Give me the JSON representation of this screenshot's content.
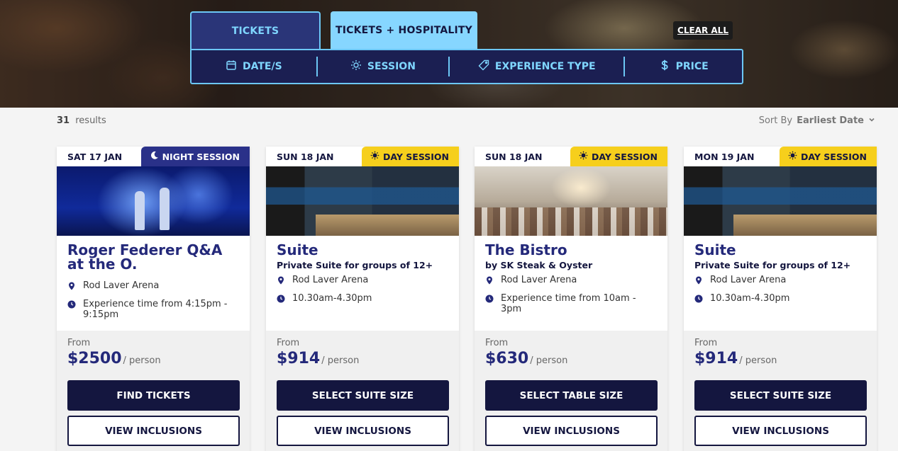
{
  "tabs": [
    {
      "label": "TICKETS",
      "active": false
    },
    {
      "label": "TICKETS + HOSPITALITY",
      "active": true
    }
  ],
  "clear_all_label": "CLEAR ALL",
  "filters": [
    {
      "label": "DATE/S",
      "icon": "calendar-icon"
    },
    {
      "label": "SESSION",
      "icon": "sun-icon"
    },
    {
      "label": "EXPERIENCE TYPE",
      "icon": "tag-icon"
    },
    {
      "label": "PRICE",
      "icon": "dollar-icon"
    }
  ],
  "results": {
    "count": "31",
    "label": "results"
  },
  "sort": {
    "label": "Sort By",
    "value": "Earliest Date",
    "icon": "chevron-down-icon"
  },
  "colors": {
    "navy": "#14163f",
    "accent_blue": "#6cc7f5",
    "night_badge": "#2a3189",
    "day_badge": "#f6cf1c",
    "title_blue": "#24297a"
  },
  "cards": [
    {
      "date": "SAT 17 JAN",
      "session": "NIGHT SESSION",
      "session_icon": "moon-icon",
      "title": "Roger Federer Q&A at the O.",
      "subtitle": "",
      "venue": "Rod Laver Arena",
      "time": "Experience time from 4:15pm - 9:15pm",
      "from_label": "From",
      "price": "$2500",
      "per": "/ person",
      "primary_button": "FIND TICKETS",
      "secondary_button": "VIEW INCLUSIONS"
    },
    {
      "date": "SUN 18 JAN",
      "session": "DAY SESSION",
      "session_icon": "sun-icon",
      "title": "Suite",
      "subtitle": "Private Suite for groups of 12+",
      "venue": "Rod Laver Arena",
      "time": "10.30am-4.30pm",
      "from_label": "From",
      "price": "$914",
      "per": "/ person",
      "primary_button": "SELECT SUITE SIZE",
      "secondary_button": "VIEW INCLUSIONS"
    },
    {
      "date": "SUN 18 JAN",
      "session": "DAY SESSION",
      "session_icon": "sun-icon",
      "title": "The Bistro",
      "subtitle": "by SK Steak & Oyster",
      "venue": "Rod Laver Arena",
      "time": "Experience time from 10am - 3pm",
      "from_label": "From",
      "price": "$630",
      "per": "/ person",
      "primary_button": "SELECT TABLE SIZE",
      "secondary_button": "VIEW INCLUSIONS"
    },
    {
      "date": "MON 19 JAN",
      "session": "DAY SESSION",
      "session_icon": "sun-icon",
      "title": "Suite",
      "subtitle": "Private Suite for groups of 12+",
      "venue": "Rod Laver Arena",
      "time": "10.30am-4.30pm",
      "from_label": "From",
      "price": "$914",
      "per": "/ person",
      "primary_button": "SELECT SUITE SIZE",
      "secondary_button": "VIEW INCLUSIONS"
    }
  ]
}
